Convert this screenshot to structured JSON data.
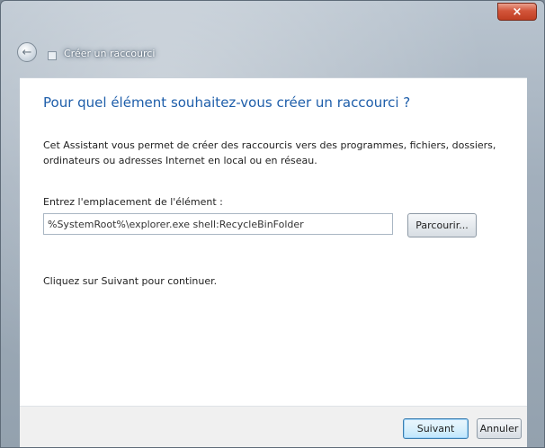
{
  "window": {
    "title": "Créer un raccourci",
    "close_glyph": "×",
    "back_glyph": "←"
  },
  "page": {
    "heading": "Pour quel élément souhaitez-vous créer un raccourci ?",
    "description": "Cet Assistant vous permet de créer des raccourcis vers des programmes, fichiers, dossiers, ordinateurs ou adresses Internet en local ou en réseau.",
    "location_label": "Entrez l'emplacement de l'élément :",
    "location_value": "%SystemRoot%\\explorer.exe shell:RecycleBinFolder",
    "browse_label": "Parcourir...",
    "hint": "Cliquez sur Suivant pour continuer."
  },
  "footer": {
    "next_label": "Suivant",
    "cancel_label": "Annuler"
  },
  "icons": {
    "back": "back-arrow-icon",
    "wizard": "shortcut-wizard-icon",
    "close": "close-icon"
  },
  "colors": {
    "heading": "#1e5eaa",
    "close_button": "#c9492d",
    "default_button_border": "#3c7fb1"
  }
}
